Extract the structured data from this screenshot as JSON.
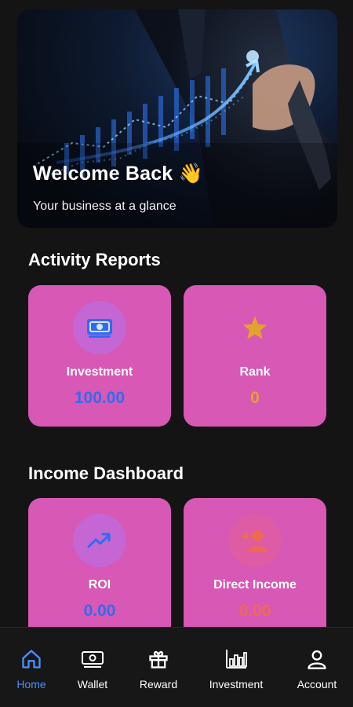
{
  "hero": {
    "title": "Welcome Back 👋",
    "subtitle": "Your business at a glance"
  },
  "activity": {
    "title": "Activity Reports",
    "cards": [
      {
        "label": "Investment",
        "value": "100.00",
        "icon": "money-icon",
        "value_color": "#2f6cf0"
      },
      {
        "label": "Rank",
        "value": "0",
        "icon": "star-icon",
        "value_color": "#e2a32c"
      }
    ]
  },
  "income": {
    "title": "Income Dashboard",
    "cards": [
      {
        "label": "ROI",
        "value": "0.00",
        "icon": "trend-up-icon",
        "value_color": "#2f6cf0"
      },
      {
        "label": "Direct Income",
        "value": "0.00",
        "icon": "add-user-icon",
        "value_color": "#f06a52"
      }
    ]
  },
  "nav": {
    "items": [
      {
        "label": "Home",
        "icon": "home-icon",
        "active": true
      },
      {
        "label": "Wallet",
        "icon": "wallet-icon",
        "active": false
      },
      {
        "label": "Reward",
        "icon": "gift-icon",
        "active": false
      },
      {
        "label": "Investment",
        "icon": "bar-chart-icon",
        "active": false
      },
      {
        "label": "Account",
        "icon": "account-icon",
        "active": false
      }
    ]
  },
  "colors": {
    "card_bg": "#d758b5",
    "accent_blue": "#2f6cf0",
    "background": "#141414"
  }
}
